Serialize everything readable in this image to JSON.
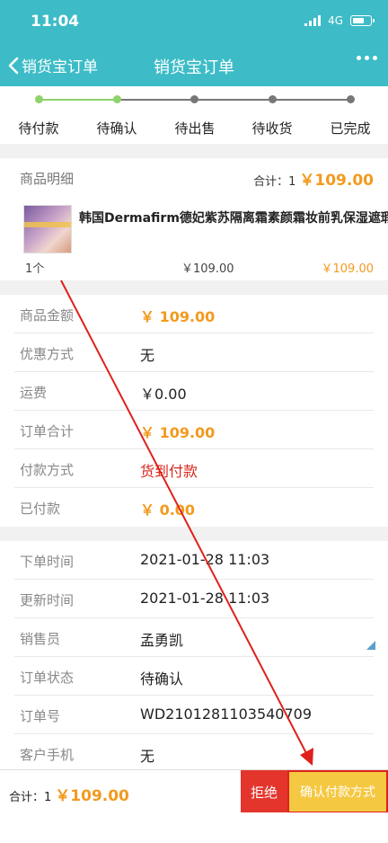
{
  "status_bar": {
    "time": "11:04",
    "network": "4G"
  },
  "nav": {
    "back_label": "销货宝订单",
    "title": "销货宝订单"
  },
  "steps": [
    {
      "label": "待付款",
      "done": true
    },
    {
      "label": "待确认",
      "done": true
    },
    {
      "label": "待出售",
      "done": false
    },
    {
      "label": "待收货",
      "done": false
    },
    {
      "label": "已完成",
      "done": false
    }
  ],
  "goods": {
    "header": "商品明细",
    "total_count_label": "合计：1",
    "total_price": "￥109.00",
    "item": {
      "name": "韩国Dermafirm德妃紫苏隔离霜素颜霜妆前乳保湿遮瑕",
      "qty": "1个",
      "unit_price": "￥109.00",
      "line_total": "￥109.00"
    }
  },
  "summary": [
    {
      "label": "商品金额",
      "value": "￥ 109.00",
      "style": "price"
    },
    {
      "label": "优惠方式",
      "value": "无",
      "style": "normal"
    },
    {
      "label": "运费",
      "value": "￥0.00",
      "style": "normal"
    },
    {
      "label": "订单合计",
      "value": "￥ 109.00",
      "style": "price"
    },
    {
      "label": "付款方式",
      "value": "货到付款",
      "style": "red"
    },
    {
      "label": "已付款",
      "value": "￥ 0.00",
      "style": "price"
    }
  ],
  "order_info": [
    {
      "label": "下单时间",
      "value": "2021-01-28 11:03"
    },
    {
      "label": "更新时间",
      "value": "2021-01-28 11:03"
    },
    {
      "label": "销售员",
      "value": "孟勇凯"
    },
    {
      "label": "订单状态",
      "value": "待确认"
    },
    {
      "label": "订单号",
      "value": "WD210128110354070​9"
    },
    {
      "label": "客户手机",
      "value": "无"
    }
  ],
  "bottom": {
    "sum_label": "合计：1",
    "sum_price": "￥109.00",
    "reject_label": "拒绝",
    "confirm_label": "确认付款方式"
  },
  "colors": {
    "header_bg": "#3dbcc7",
    "step_done": "#8ed36b",
    "step_todo": "#777777",
    "price": "#f39a1e",
    "red_text": "#d9261c",
    "reject_bg": "#e4352d",
    "confirm_bg": "#f5c842",
    "annotation": "#e0201a"
  }
}
